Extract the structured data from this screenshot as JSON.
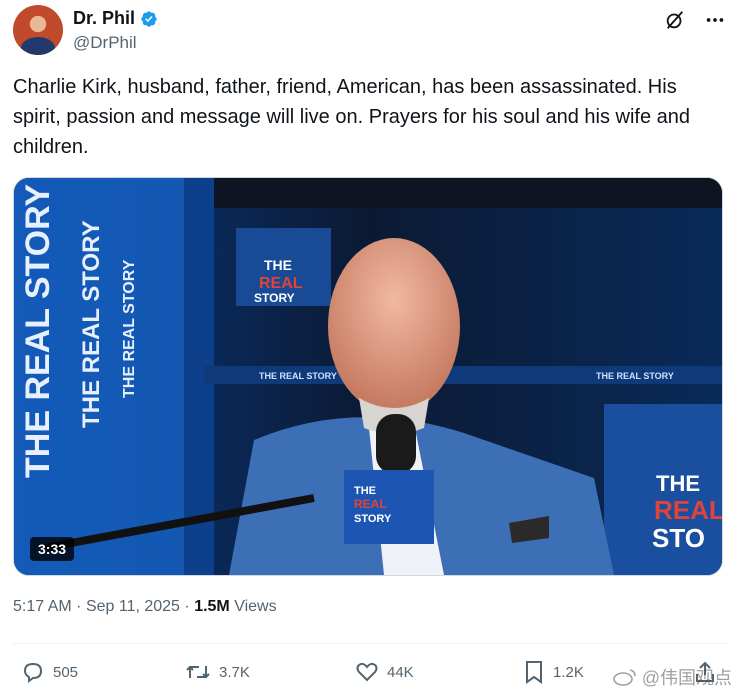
{
  "author": {
    "display_name": "Dr. Phil",
    "handle": "@DrPhil"
  },
  "tweet": {
    "text": "Charlie Kirk, husband, father, friend, American, has been assassinated. His spirit, passion and message will live on. Prayers for his soul and his wife and children."
  },
  "media": {
    "duration": "3:33",
    "banner_text": "THE REAL STORY",
    "logo_text_top": "THE",
    "logo_text_mid": "REAL",
    "logo_text_bottom": "STORY",
    "right_logo_l1": "THE",
    "right_logo_l2": "REAL",
    "right_logo_l3": "STO",
    "ledge_left": "THE REAL STORY",
    "ledge_right": "THE REAL STORY",
    "mic_l1": "THE",
    "mic_l2": "REAL",
    "mic_l3": "STORY"
  },
  "meta": {
    "time": "5:17 AM",
    "date": "Sep 11, 2025",
    "views_count": "1.5M",
    "views_label": "Views"
  },
  "actions": {
    "replies": "505",
    "reposts": "3.7K",
    "likes": "44K",
    "bookmarks": "1.2K"
  },
  "watermark": "@伟国观点",
  "colors": {
    "verified": "#1d9bf0",
    "text_secondary": "#536471",
    "brand_red": "#e0433b"
  }
}
